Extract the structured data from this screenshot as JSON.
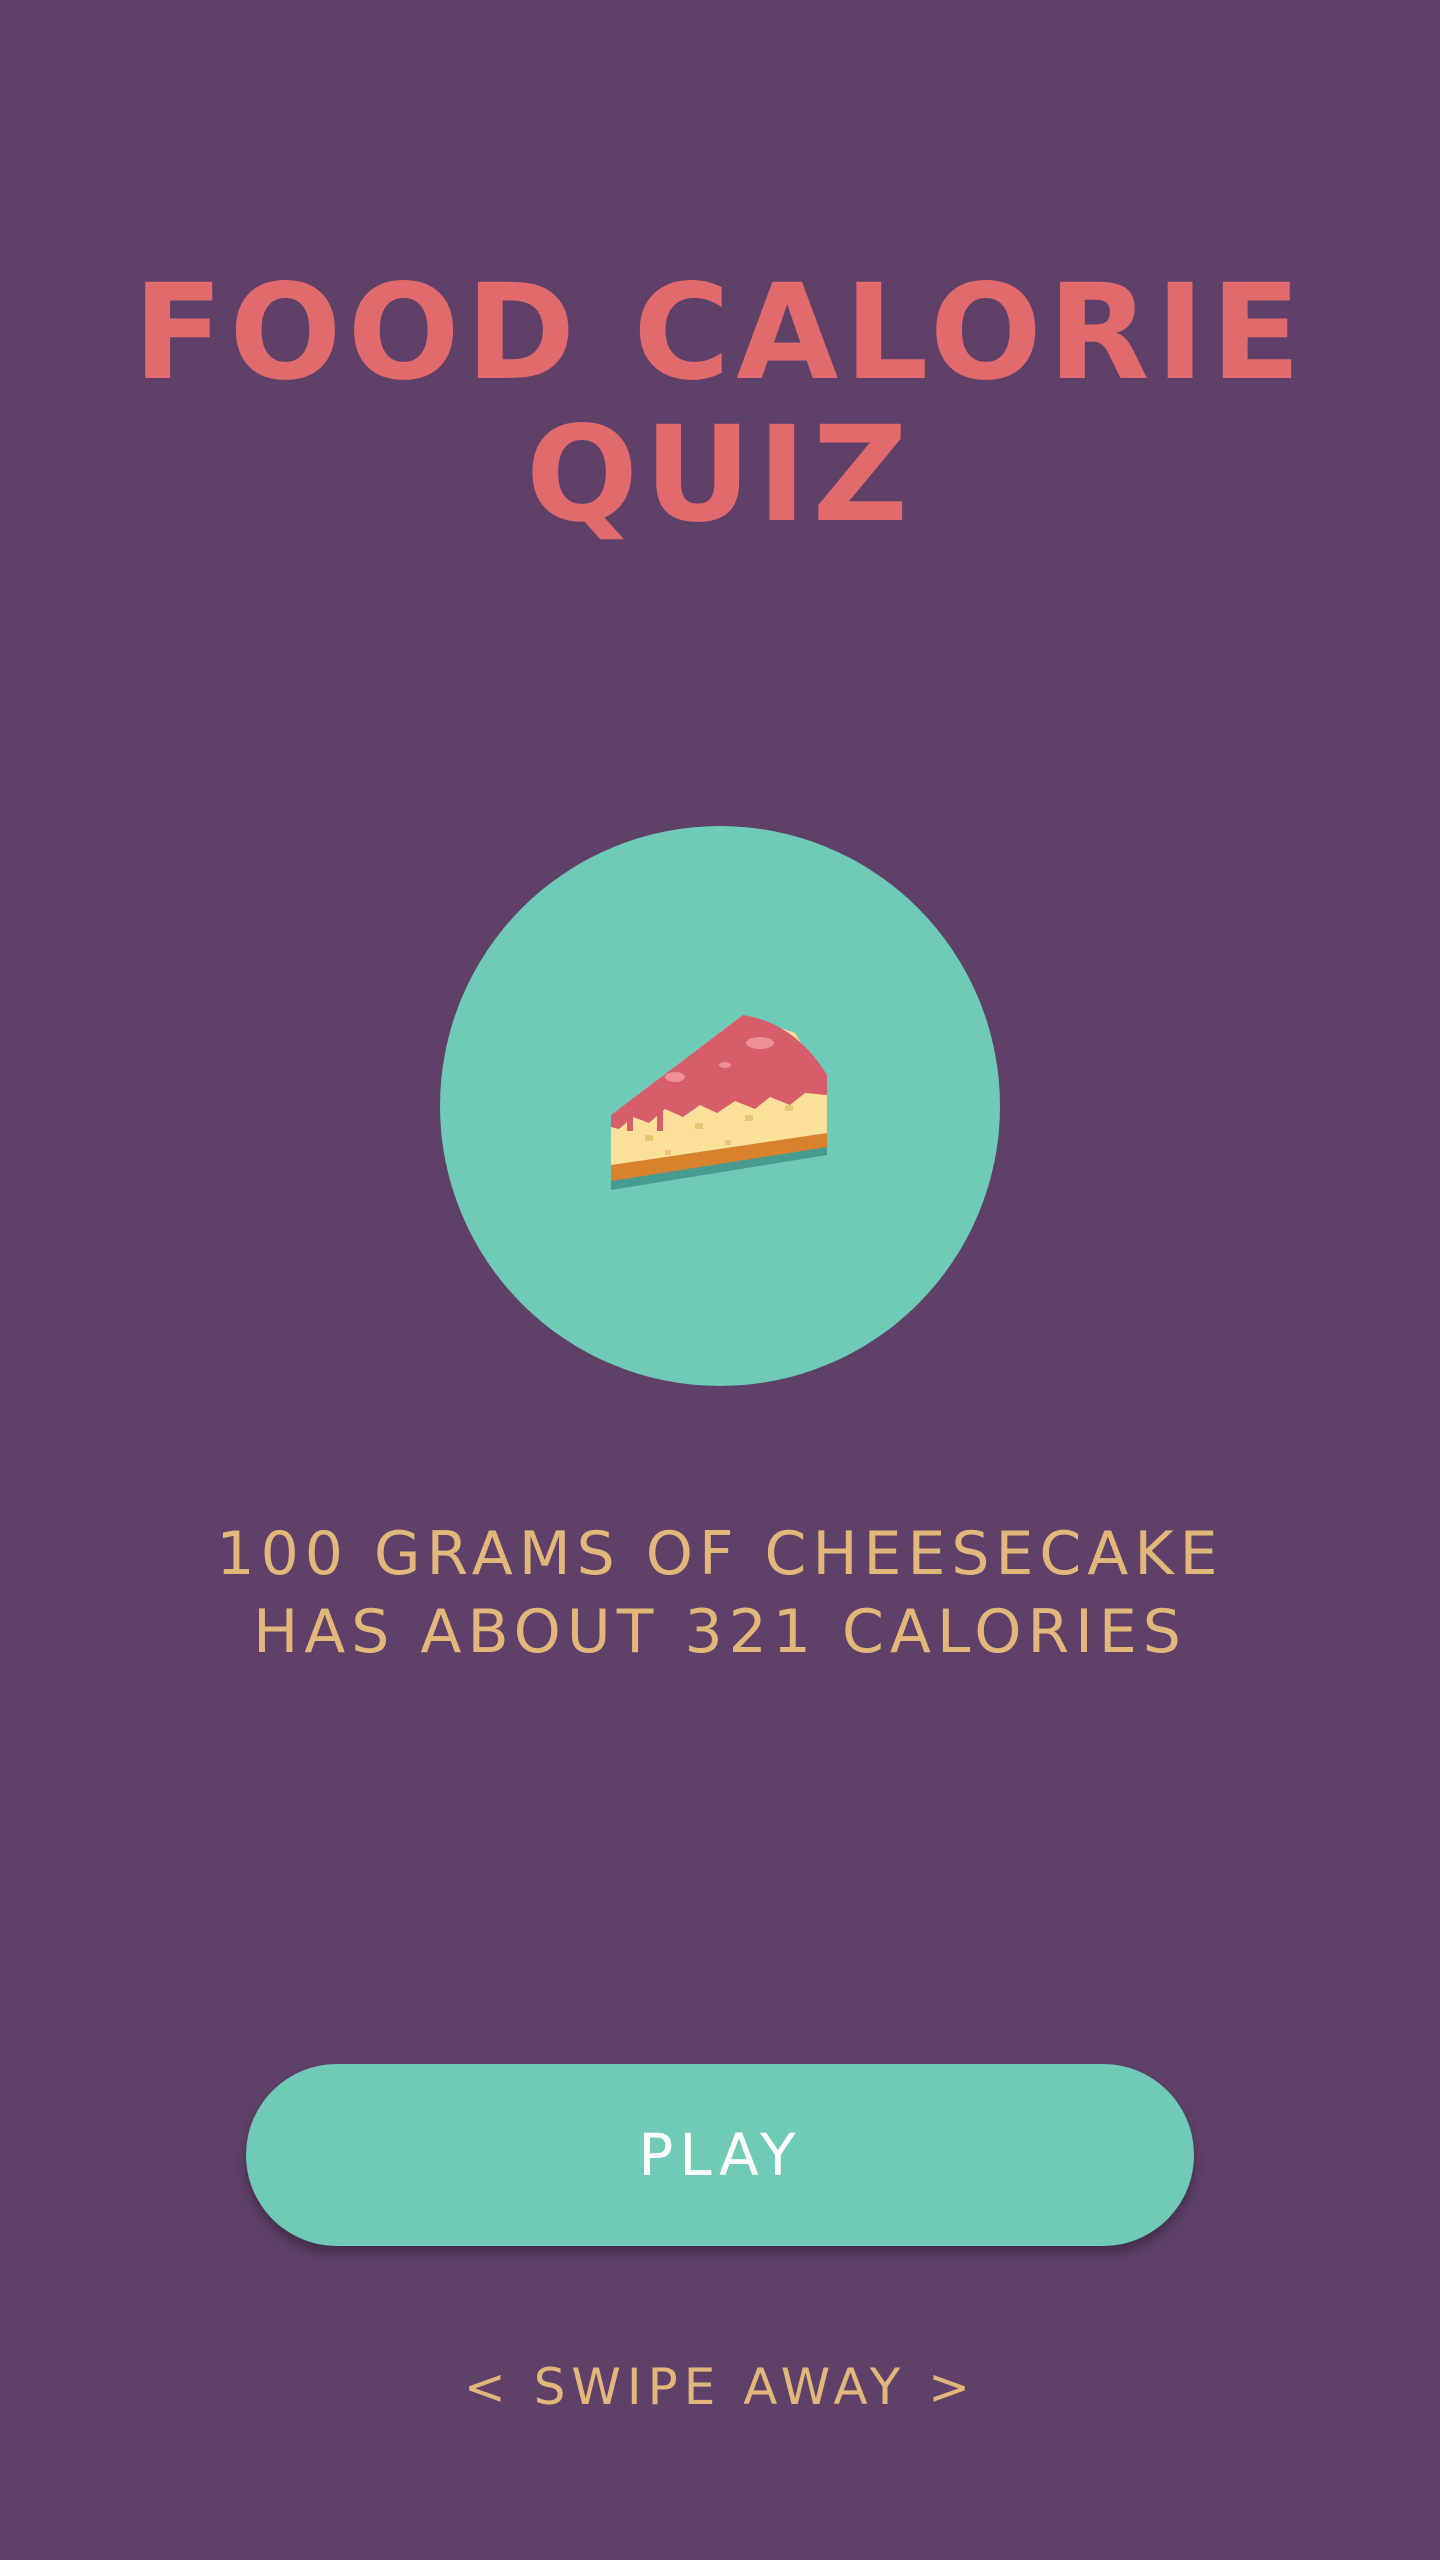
{
  "title": {
    "line1": "FOOD CALORIE",
    "line2": "QUIZ"
  },
  "food": {
    "icon": "cheesecake-icon"
  },
  "fact": {
    "line1": "100 GRAMS OF CHEESECAKE",
    "line2": "HAS ABOUT 321 CALORIES"
  },
  "play_button": {
    "label": "PLAY"
  },
  "swipe_hint": "< SWIPE AWAY >",
  "colors": {
    "background": "#5e4069",
    "title": "#e06a6c",
    "accent": "#6fcbb8",
    "text": "#e2b87a",
    "button_text": "#ffffff"
  }
}
